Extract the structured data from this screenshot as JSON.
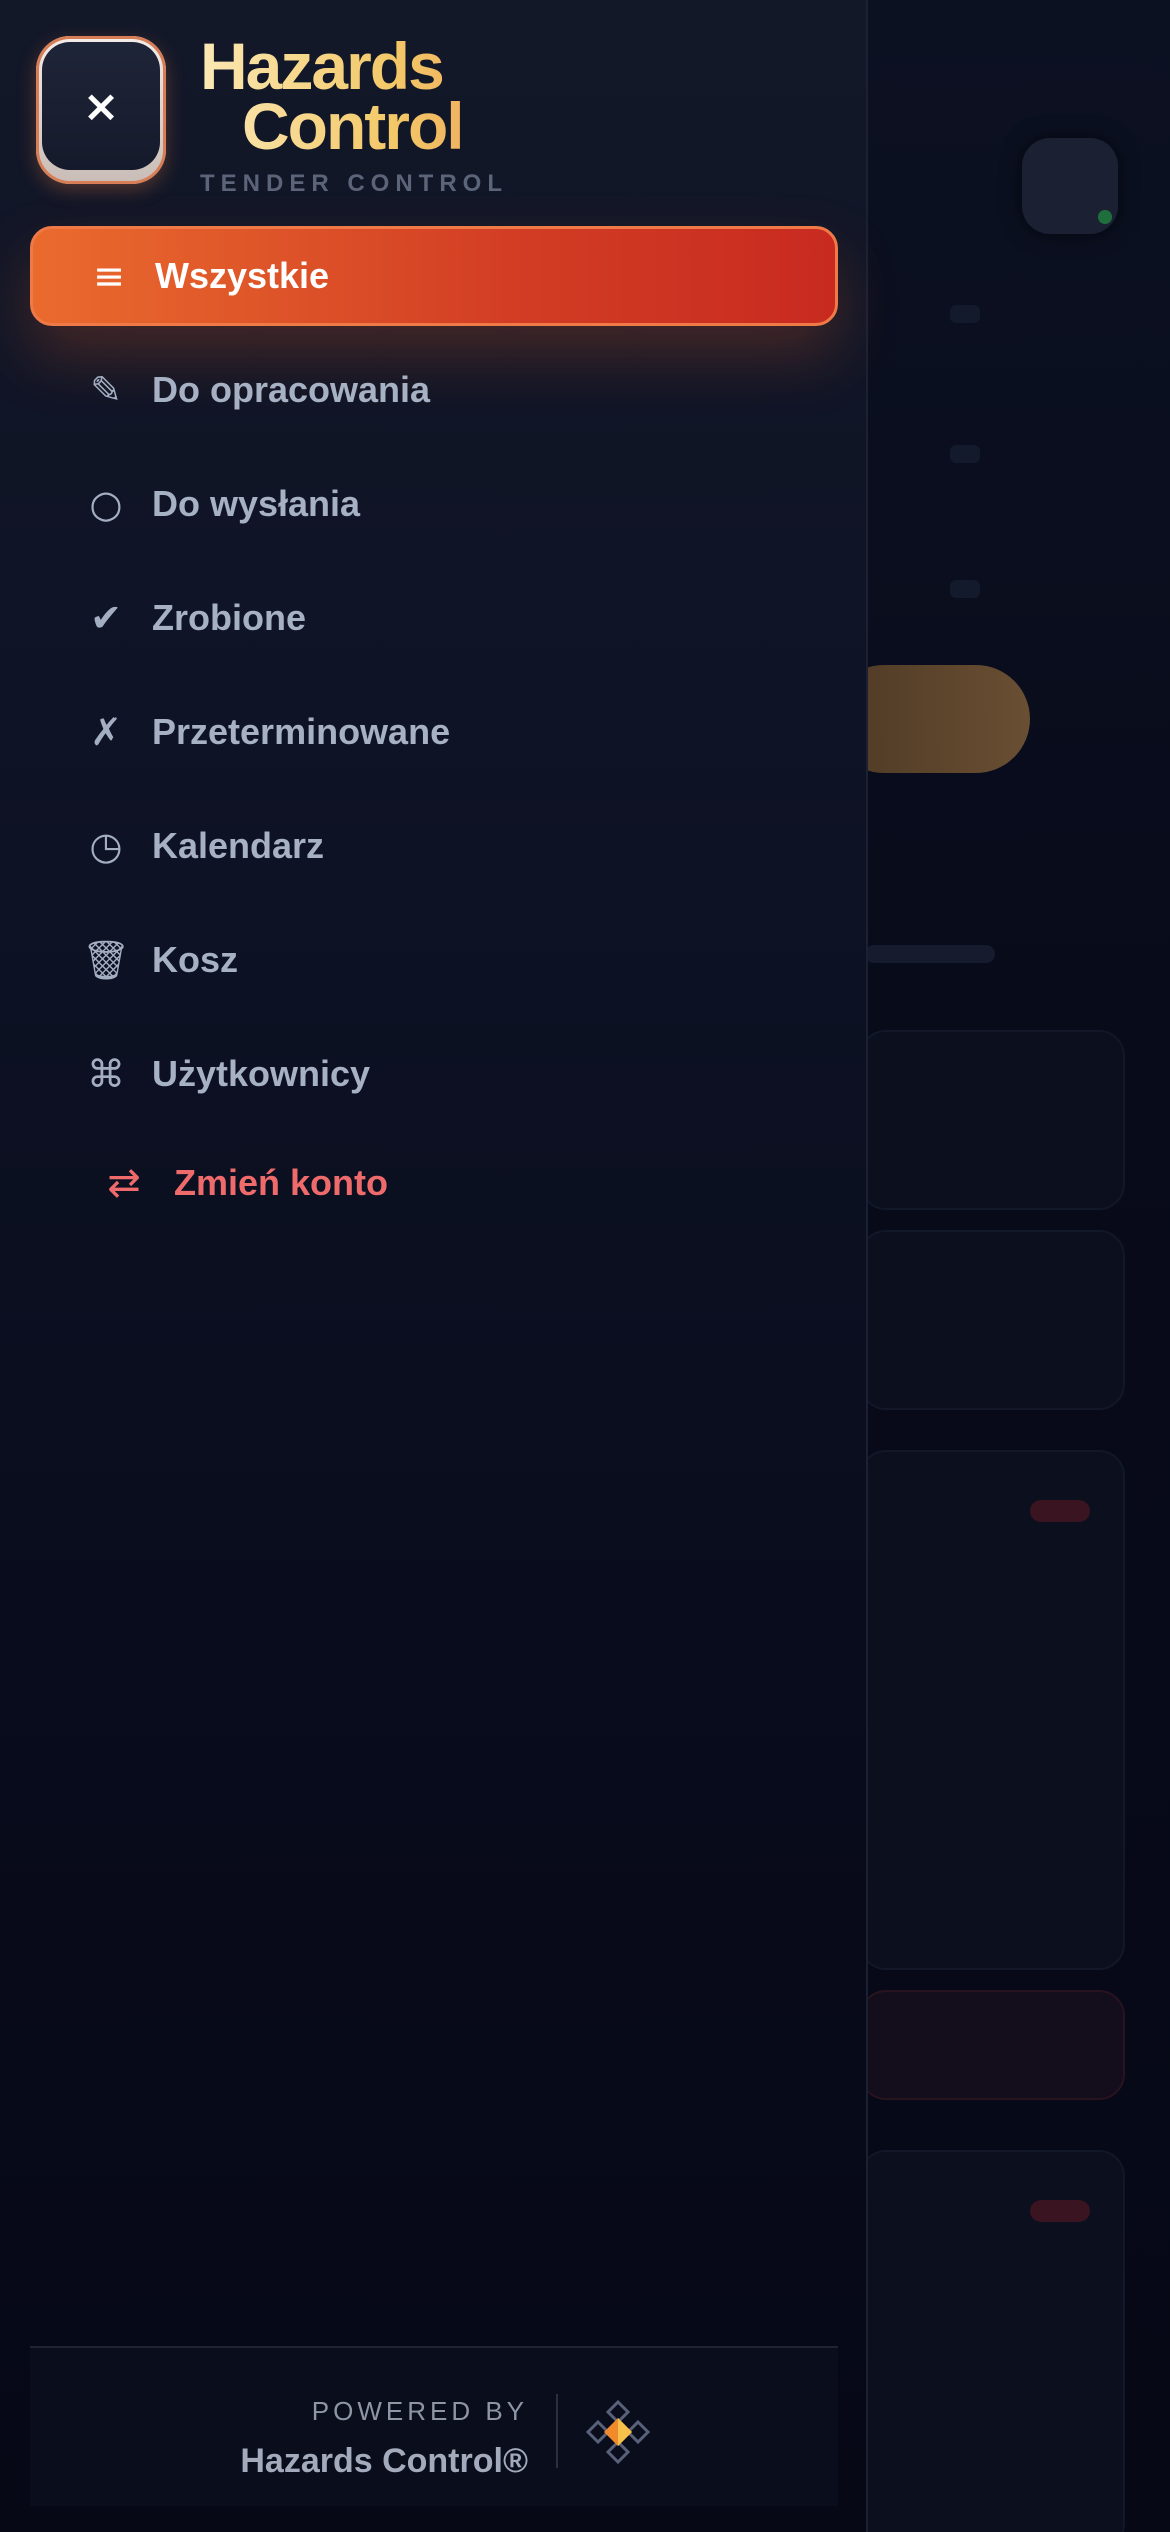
{
  "header": {
    "close_icon": "×",
    "brand_line1": "Hazards",
    "brand_line2": "Control",
    "brand_subtitle": "TENDER CONTROL"
  },
  "menu": {
    "items": [
      {
        "label": "Wszystkie",
        "icon": "≡",
        "icon_name": "list-icon",
        "active": true
      },
      {
        "label": "Do opracowania",
        "icon": "✎",
        "icon_name": "pencil-icon",
        "active": false
      },
      {
        "label": "Do wysłania",
        "icon": "○",
        "icon_name": "circle-icon",
        "active": false
      },
      {
        "label": "Zrobione",
        "icon": "✔",
        "icon_name": "check-icon",
        "active": false
      },
      {
        "label": "Przeterminowane",
        "icon": "✗",
        "icon_name": "cross-icon",
        "active": false
      },
      {
        "label": "Kalendarz",
        "icon": "◷",
        "icon_name": "clock-icon",
        "active": false
      },
      {
        "label": "Kosz",
        "icon": "🗑",
        "icon_name": "trash-icon",
        "active": false
      },
      {
        "label": "Użytkownicy",
        "icon": "⌘",
        "icon_name": "command-icon",
        "active": false
      }
    ],
    "switch_account": {
      "label": "Zmień konto",
      "icon": "⇄",
      "icon_name": "swap-icon"
    }
  },
  "footer": {
    "powered_by": "POWERED BY",
    "name": "Hazards Control®"
  },
  "colors": {
    "accent_start": "#ea6b2e",
    "accent_end": "#c82a1f",
    "switch_account": "#ef6b6b",
    "drawer_bg": "#0d1224"
  }
}
